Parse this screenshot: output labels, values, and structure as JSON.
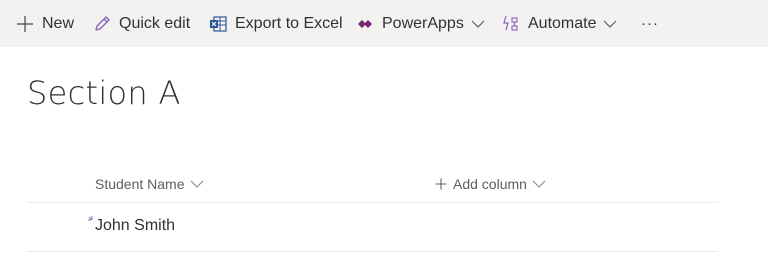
{
  "toolbar": {
    "new_label": "New",
    "quick_edit_label": "Quick edit",
    "export_label": "Export to Excel",
    "powerapps_label": "PowerApps",
    "automate_label": "Automate",
    "more_label": "···"
  },
  "page": {
    "title": "Section A"
  },
  "list": {
    "columns": [
      {
        "label": "Student Name"
      },
      {
        "label": "Add column"
      }
    ],
    "rows": [
      {
        "student_name": "John Smith"
      }
    ]
  },
  "colors": {
    "toolbar_bg": "#f3f2f1",
    "accent": "#8764b8",
    "excel_icon": "#2b579a",
    "powerapps_icon": "#742774",
    "text": "#323130",
    "muted_text": "#605e5c"
  },
  "icons": [
    "plus-icon",
    "pencil-icon",
    "excel-icon",
    "powerapps-icon",
    "automate-icon",
    "chevron-down-icon",
    "more-icon",
    "new-item-spark-icon"
  ]
}
